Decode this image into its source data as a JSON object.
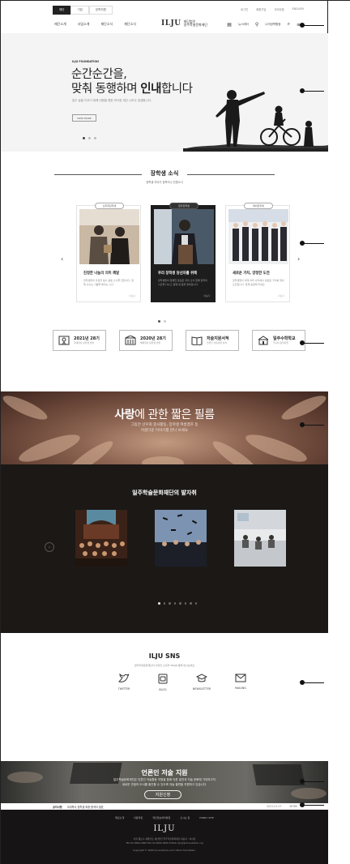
{
  "utility": {
    "tabs": [
      "재단",
      "기업",
      "장학지원"
    ],
    "links": [
      "로그인",
      "회원가입",
      "사이트맵",
      "ENGLISH"
    ]
  },
  "gnb": {
    "menu": [
      "재단소개",
      "사업소개",
      "재단소식",
      "재단소식"
    ],
    "logo_mark": "ILJU",
    "logo_text_1": "재단법인",
    "logo_text_2": "일주학술문화재단",
    "right": [
      "뉴스레터",
      "나의장학활동"
    ]
  },
  "hero": {
    "tag": "ILJU FOUNDATION",
    "title_line1": "순간순간을,",
    "title_line2_pre": "맞춰 동행하며 ",
    "title_line2_bold": "인내",
    "title_line2_post": "합니다",
    "sub": "일주 술을 이르기 위해 내원을 향한 보다한 재단 나아주 생생합니다.",
    "more": "VIEW MORE"
  },
  "news": {
    "title": "장학생 소식",
    "sub": "장학생 이야기 장학이나 단원소식",
    "cards": [
      {
        "badge": "선우회장학생",
        "title": "진정한 나눔의 의미 깨달",
        "desc": "장학생들의 다양한 봉사 활동 소식을 전합니다. 함께 나누는 기쁨을 배우는 시간",
        "more": "더보기"
      },
      {
        "badge": "일주장학생",
        "title": "우리 장학생 당선자를 위해",
        "desc": "장학생들이 함께한 뜻깊은 자리 소식 함께 장학의 시간을 나누고 함께 새 길을 찾아갑니다.",
        "more": "더보기"
      },
      {
        "badge": "해외장학생",
        "title": "새로운 가치, 양정한 도전",
        "desc": "장학생들이 세계 여러 나라에서 새로운 가치를 찾아 도전합니다. 함께 응원해 주세요.",
        "more": "더보기"
      }
    ],
    "quick": [
      {
        "title_l1": "2021년 28기",
        "title_l2": "",
        "sub": "국내학사 장학생 선발"
      },
      {
        "title_l1": "2020년 28기",
        "title_l2": "",
        "sub": "해외학사 장학생 선발"
      },
      {
        "title_l1": "저술지원서적",
        "title_l2": "",
        "sub": "언론인 저술지원 서적"
      },
      {
        "title_l1": "일주수학학교",
        "title_l2": "",
        "sub": "주니어 장학사업"
      }
    ]
  },
  "film": {
    "title_bold": "사랑",
    "title_rest": "에 관한 짧은 필름",
    "desc_l1": "그동안 선우회 봉사활동, 장학생 여름캠프 등",
    "desc_l2": "아름다운 이야기를 만나 보세요"
  },
  "footprints": {
    "title": "일주학술문화재단의 발자취"
  },
  "sns": {
    "title": "ILJU SNS",
    "sub": "일주학술문화재단의 다양한 소식을 SNS를 통해 만나보세요",
    "items": [
      {
        "label": "TWITTER",
        "icon": "twitter-icon"
      },
      {
        "label": "BLOG",
        "icon": "blog-icon"
      },
      {
        "label": "NEWSLETTER",
        "icon": "graduation-cap-icon"
      },
      {
        "label": "MAILING",
        "icon": "mail-icon"
      }
    ]
  },
  "press": {
    "title": "언론인 저술 지원",
    "desc_l1": "일주학술문화재단은 언론인 저술활동 지원을 통해 언론 발전과 저술 문화에 기여하고자",
    "desc_l2": "새로운 관점의 도서를 출간할 수 있도록 저술 출판을 지원하고 있습니다.",
    "button": "지원신청"
  },
  "notice": {
    "label": "공지사항",
    "text": "국내학사 장학생 최종 합격자 발표",
    "date": "2021.01.27",
    "more": "MORE"
  },
  "footer": {
    "links": [
      "재단소개",
      "이용약관",
      "개인정보처리방침",
      "오시는 길",
      "FAMILY SITE"
    ],
    "logo": "ILJU",
    "info_l1": "서울 종로구 새문안로 재단법인 일주학술문화재단 대표자 : 이사장",
    "info_l2": "TEL 02-0000-0000  FAX 02-0000-0000  E-MAIL ilju@iljufoundation.org",
    "copyright": "Copyright © 2020 Ilju academy and culture foundation."
  },
  "colors": {
    "dark": "#1b1816",
    "film": "#8e6552",
    "accent": "#222222"
  }
}
